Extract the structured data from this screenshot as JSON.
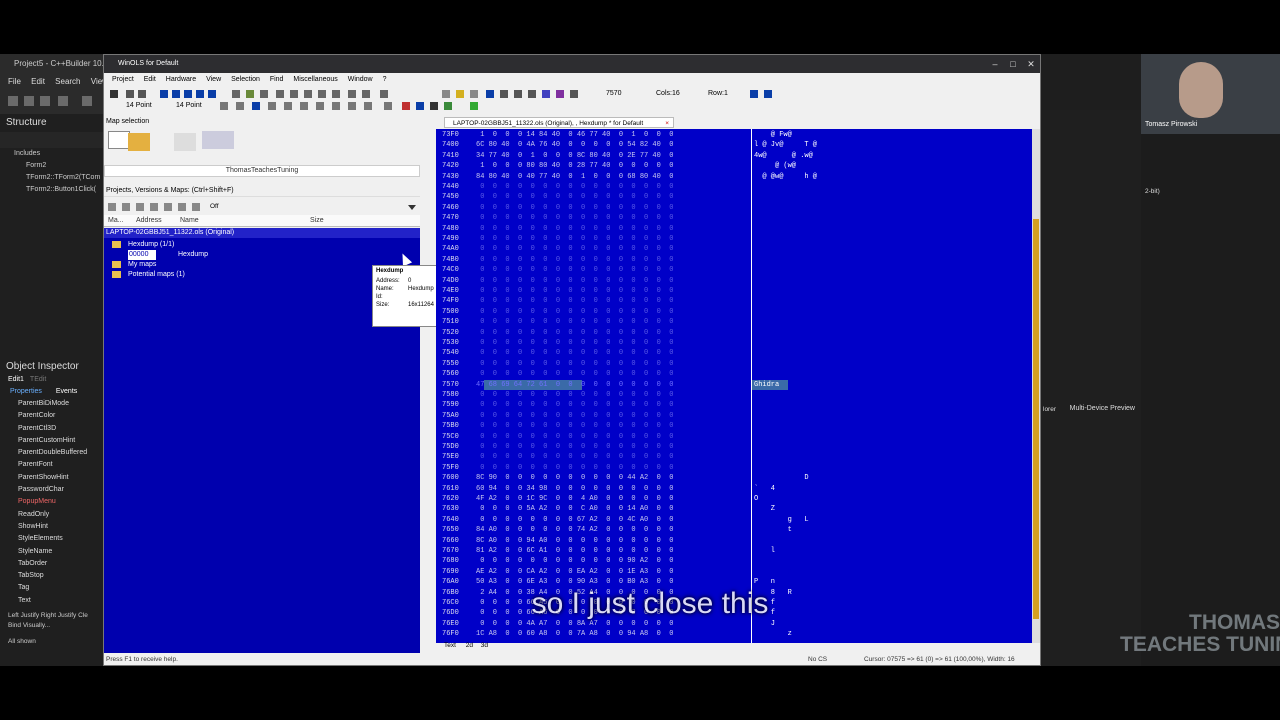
{
  "ide": {
    "title": "Project5 - C++Builder 10...",
    "menu": [
      "File",
      "Edit",
      "Search",
      "View"
    ],
    "structure_title": "Structure",
    "structure_items": [
      "Includes",
      "Form2",
      "TForm2::TForm2(TCom",
      "TForm2::Button1Click("
    ],
    "object_inspector_title": "Object Inspector",
    "object_inspector_obj": "Edit1",
    "object_inspector_obj2": "TEdit",
    "oi_tabs": [
      "Properties",
      "Events"
    ],
    "oi_props": [
      "ParentBiDiMode",
      "ParentColor",
      "ParentCtl3D",
      "ParentCustomHint",
      "ParentDoubleBuffered",
      "ParentFont",
      "ParentShowHint",
      "PasswordChar",
      "PopupMenu",
      "ReadOnly",
      "ShowHint",
      "StyleElements",
      "StyleName",
      "TabOrder",
      "TabStop",
      "Tag",
      "Text"
    ],
    "oi_bottom": "Left Justify  Right Justify  Cle",
    "oi_bind": "Bind Visually...",
    "oi_allshown": "All shown",
    "multi_device_preview": "Multi-Device Preview",
    "rside_note": "2-bit)",
    "xplorer": "lorer"
  },
  "webcam": {
    "name": "Tomasz Pirowski"
  },
  "watermark": {
    "line1": "THOMAS",
    "line2": "TEACHES TUNING"
  },
  "winols": {
    "title": "WinOLS for Default",
    "menu": [
      "Project",
      "Edit",
      "Hardware",
      "View",
      "Selection",
      "Find",
      "Miscellaneous",
      "Window",
      "?"
    ],
    "font_size_a": "14 Point",
    "font_size_b": "14 Point",
    "addr_field": "7570",
    "cols_label": "Cols:16",
    "row_label": "Row:1",
    "map_selection_title": "Map selection",
    "owner": "ThomasTeachesTuning",
    "projects_header": "Projects, Versions & Maps: (Ctrl+Shift+F)",
    "filter_off": "Off",
    "col_headers": [
      "Ma...",
      "Address",
      "Name",
      "Size"
    ],
    "tree_header": "LAPTOP-02GBBJ51_11322.ols (Original)",
    "tree_items": [
      {
        "label": "Hexdump (1/1)"
      },
      {
        "label": "00000",
        "name": "Hexdump"
      },
      {
        "label": "My maps"
      },
      {
        "label": "Potential maps (1)"
      }
    ],
    "tooltip": {
      "title": "Hexdump",
      "rows": [
        [
          "Address:",
          "0"
        ],
        [
          "Name:",
          "Hexdump"
        ],
        [
          "Id:",
          ""
        ],
        [
          "Size:",
          "16x11264 (8 Bit)"
        ]
      ]
    },
    "hex_tab": "LAPTOP-02GBBJ51_11322.ols (Original), , Hexdump * for Default",
    "hex_rows": [
      {
        "a": "73F0",
        "b": " 1  0  0  0 14 84 40  0 46 77 40  0  1  0  0  0",
        "c": "    @ Fw@"
      },
      {
        "a": "7400",
        "b": "6C 80 40  0 4A 76 40  0  0  0  0  0 54 82 40  0",
        "c": "l @ Jv@     T @"
      },
      {
        "a": "7410",
        "b": "34 77 40  0  1  0  0  0 8C 80 40  0 2E 77 40  0",
        "c": "4w@      @ .w@"
      },
      {
        "a": "7420",
        "b": " 1  0  0  0 80 80 40  0 28 77 40  0  0  0  0  0",
        "c": "     @ (w@"
      },
      {
        "a": "7430",
        "b": "84 80 40  0 40 77 40  0  1  0  0  0 68 80 40  0",
        "c": "  @ @w@     h @"
      },
      {
        "a": "7440",
        "z": 1
      },
      {
        "a": "7450",
        "z": 1
      },
      {
        "a": "7460",
        "z": 1
      },
      {
        "a": "7470",
        "z": 1
      },
      {
        "a": "7480",
        "z": 1
      },
      {
        "a": "7490",
        "z": 1
      },
      {
        "a": "74A0",
        "z": 1
      },
      {
        "a": "74B0",
        "z": 1
      },
      {
        "a": "74C0",
        "z": 1
      },
      {
        "a": "74D0",
        "z": 1
      },
      {
        "a": "74E0",
        "z": 1
      },
      {
        "a": "74F0",
        "z": 1
      },
      {
        "a": "7500",
        "z": 1
      },
      {
        "a": "7510",
        "z": 1
      },
      {
        "a": "7520",
        "z": 1
      },
      {
        "a": "7530",
        "z": 1
      },
      {
        "a": "7540",
        "z": 1
      },
      {
        "a": "7550",
        "z": 1
      },
      {
        "a": "7560",
        "z": 1
      },
      {
        "a": "7570",
        "b": "47 68 69 64 72 61  0  0  0  0  0  0  0  0  0  0",
        "c": "Ghidra",
        "sel": 1
      },
      {
        "a": "7580",
        "z": 1
      },
      {
        "a": "7590",
        "z": 1
      },
      {
        "a": "75A0",
        "z": 1
      },
      {
        "a": "75B0",
        "z": 1
      },
      {
        "a": "75C0",
        "z": 1
      },
      {
        "a": "75D0",
        "z": 1
      },
      {
        "a": "75E0",
        "z": 1
      },
      {
        "a": "75F0",
        "z": 1
      },
      {
        "a": "7600",
        "b": "8C 90  0  0  0  0  0  0  0  0  0  0 44 A2  0  0",
        "c": "            D"
      },
      {
        "a": "7610",
        "b": "60 94  0  0 34 98  0  0  0  0  0  0  0  0  0  0",
        "c": "`   4"
      },
      {
        "a": "7620",
        "b": "4F A2  0  0 1C 9C  0  0  4 A0  0  0  0  0  0  0",
        "c": "O"
      },
      {
        "a": "7630",
        "b": " 0  0  0  0 5A A2  0  0  C A0  0  0 14 A0  0  0",
        "c": "    Z"
      },
      {
        "a": "7640",
        "b": " 0  0  0  0  0  0  0  0 67 A2  0  0 4C A0  0  0",
        "c": "        g   L"
      },
      {
        "a": "7650",
        "b": "84 A0  0  0  0  0  0  0 74 A2  0  0  0  0  0  0",
        "c": "        t"
      },
      {
        "a": "7660",
        "b": "8C A0  0  0 94 A0  0  0  0  0  0  0  0  0  0  0",
        "c": ""
      },
      {
        "a": "7670",
        "b": "81 A2  0  0 6C A1  0  0  0  0  0  0  0  0  0  0",
        "c": "    l"
      },
      {
        "a": "7680",
        "b": " 0  0  0  0  0  0  0  0  0  0  0  0 90 A2  0  0",
        "c": ""
      },
      {
        "a": "7690",
        "b": "AE A2  0  0 CA A2  0  0 EA A2  0  0 1E A3  0  0",
        "c": ""
      },
      {
        "a": "76A0",
        "b": "50 A3  0  0 6E A3  0  0 90 A3  0  0 B0 A3  0  0",
        "c": "P   n"
      },
      {
        "a": "76B0",
        "b": " 2 A4  0  0 38 A4  0  0 52 A4  0  0  0  0  0  0",
        "c": "    8   R"
      },
      {
        "a": "76C0",
        "b": " 0  0  0  0 66 A5  0  0  0  0  0  0  0  0  0  0",
        "c": "    f"
      },
      {
        "a": "76D0",
        "b": " 0  0  0  0 66 A6  0  0  0  0  0  0  0  0  0  0",
        "c": "    f"
      },
      {
        "a": "76E0",
        "b": " 0  0  0  0 4A A7  0  0 8A A7  0  0  0  0  0  0",
        "c": "    J"
      },
      {
        "a": "76F0",
        "b": "1C A8  0  0 60 A8  0  0 7A A8  0  0 94 A8  0  0",
        "c": "        z"
      }
    ],
    "bottom_tabs": [
      "Text",
      "2d",
      "3d"
    ],
    "status_left": "Press F1 to receive help.",
    "status_nocs": "No CS",
    "status_cursor": "Cursor: 07575 => 61 (0) => 61 (100,00%), Width: 16"
  },
  "subtitle": "so I just close this",
  "colors": {
    "hex_bg": "#0000c8",
    "tree_bg": "#0000ae",
    "selection": "#3a6aa8"
  }
}
